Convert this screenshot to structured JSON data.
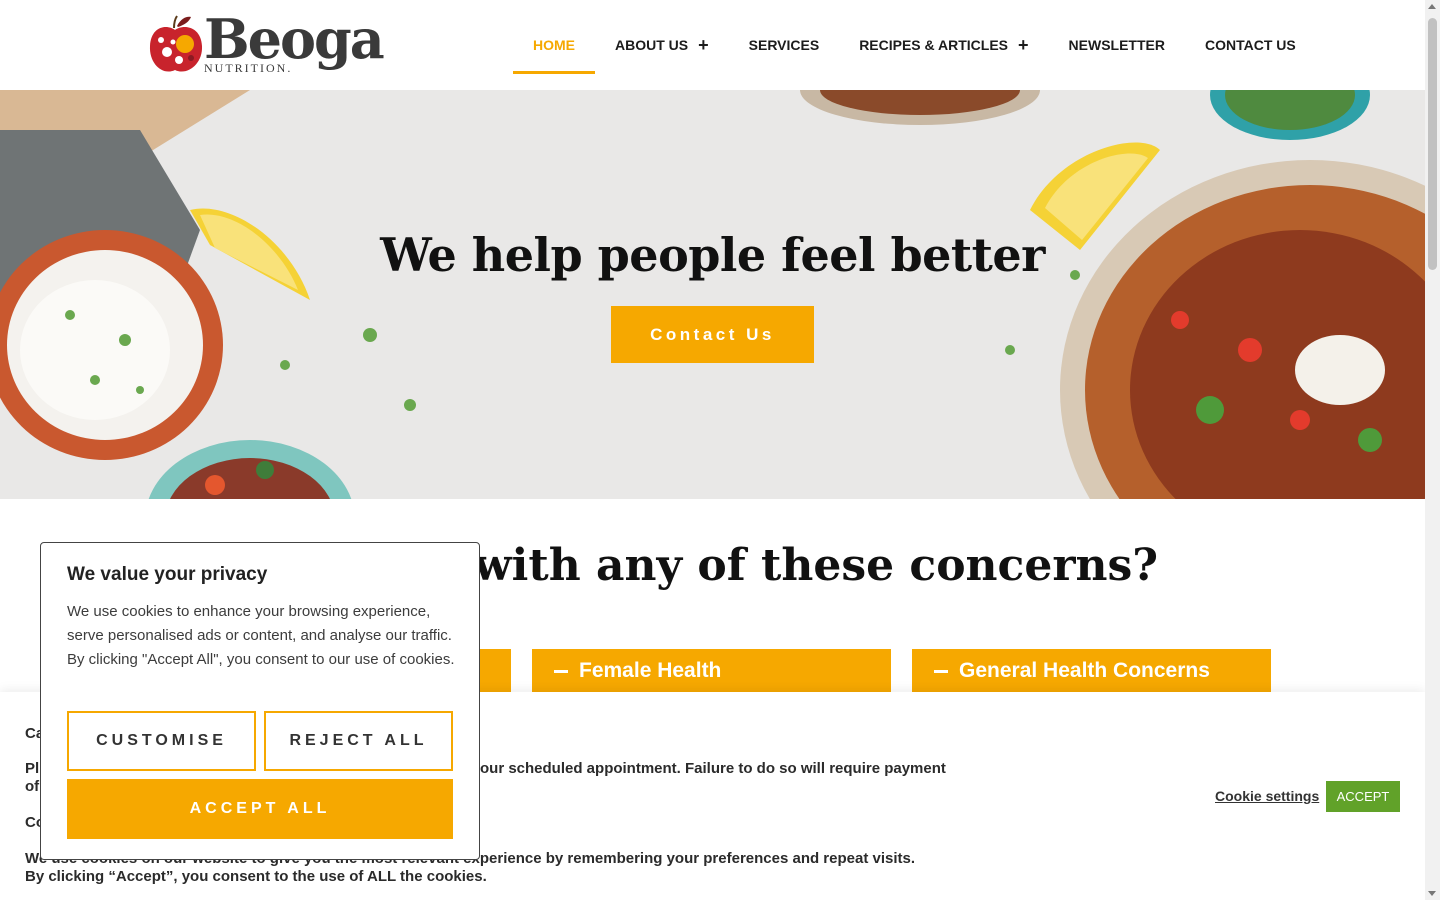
{
  "colors": {
    "accent": "#f6a800",
    "accept_green": "#61a229",
    "text_dark": "#111111"
  },
  "logo": {
    "word": "Beoga",
    "sub": "NUTRITION.",
    "icon": "apple-logo-icon"
  },
  "nav": {
    "items": [
      {
        "label": "HOME",
        "active": true,
        "has_plus": false
      },
      {
        "label": "ABOUT US",
        "active": false,
        "has_plus": true
      },
      {
        "label": "SERVICES",
        "active": false,
        "has_plus": false
      },
      {
        "label": "RECIPES & ARTICLES",
        "active": false,
        "has_plus": true
      },
      {
        "label": "NEWSLETTER",
        "active": false,
        "has_plus": false
      },
      {
        "label": "CONTACT US",
        "active": false,
        "has_plus": false
      }
    ],
    "plus_glyph": "+"
  },
  "hero": {
    "title": "We help people feel better",
    "button": "Contact Us"
  },
  "concerns": {
    "title": "d help with any of these concerns?",
    "cards": [
      {
        "label": ""
      },
      {
        "label": "Female Health"
      },
      {
        "label": "General Health Concerns"
      }
    ]
  },
  "cookie_bar": {
    "line1": "Ca",
    "line2a": "Pl",
    "line2b": "our scheduled appointment. Failure to do so will require payment",
    "line3": "of",
    "line4": "Co",
    "line5": "We use cookies on our website to give you the most relevant experience by remembering your preferences and repeat visits.",
    "line6": "By clicking “Accept”, you consent to the use of ALL the cookies.",
    "settings_label": "Cookie settings",
    "accept_label": "ACCEPT"
  },
  "privacy": {
    "title": "We value your privacy",
    "body": "We use cookies to enhance your browsing experience, serve personalised ads or content, and analyse our traffic. By clicking \"Accept All\", you consent to our use of cookies.",
    "customise": "CUSTOMISE",
    "reject": "REJECT ALL",
    "accept_all": "ACCEPT ALL"
  }
}
